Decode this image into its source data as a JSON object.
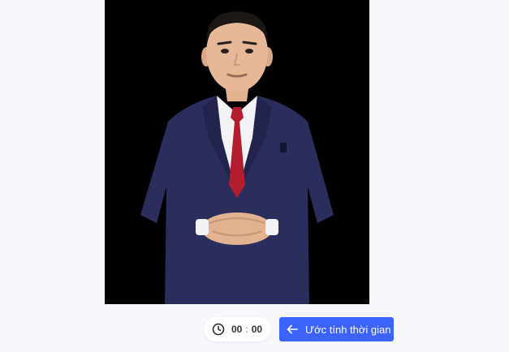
{
  "timer": {
    "minutes": "00",
    "separator": ":",
    "seconds": "00",
    "icon": "clock-icon"
  },
  "actions": {
    "estimate_label": "Ước tính thời gian",
    "estimate_icon": "arrow-left-icon"
  },
  "colors": {
    "primary": "#3d63ff",
    "page_background": "#f6f8fc",
    "video_background": "#000000",
    "suit": "#2b2e5c",
    "tie": "#b31d2e"
  }
}
